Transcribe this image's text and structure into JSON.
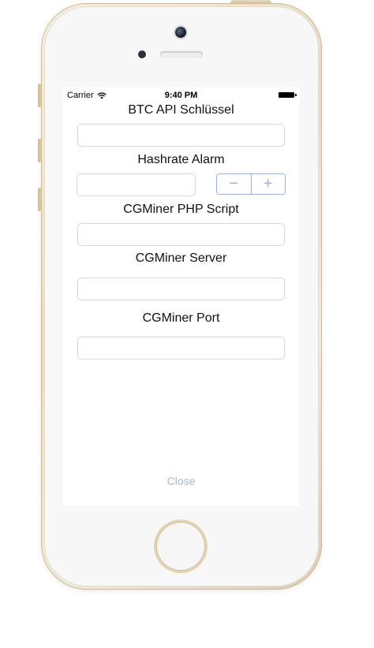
{
  "status_bar": {
    "carrier": "Carrier",
    "time": "9:40 PM"
  },
  "form": {
    "api_key": {
      "label": "BTC API Schlüssel",
      "value": "",
      "placeholder": ""
    },
    "hashrate": {
      "label": "Hashrate Alarm",
      "value": "",
      "placeholder": "",
      "minus": "−",
      "plus": "+"
    },
    "php_script": {
      "label": "CGMiner PHP Script",
      "value": "",
      "placeholder": ""
    },
    "server": {
      "label": "CGMiner Server",
      "value": "",
      "placeholder": ""
    },
    "port": {
      "label": "CGMiner Port",
      "value": "",
      "placeholder": ""
    }
  },
  "close_label": "Close",
  "colors": {
    "accent": "#9fb3d9",
    "close_text": "#a9b8d8",
    "field_border": "#d7d7d7"
  }
}
